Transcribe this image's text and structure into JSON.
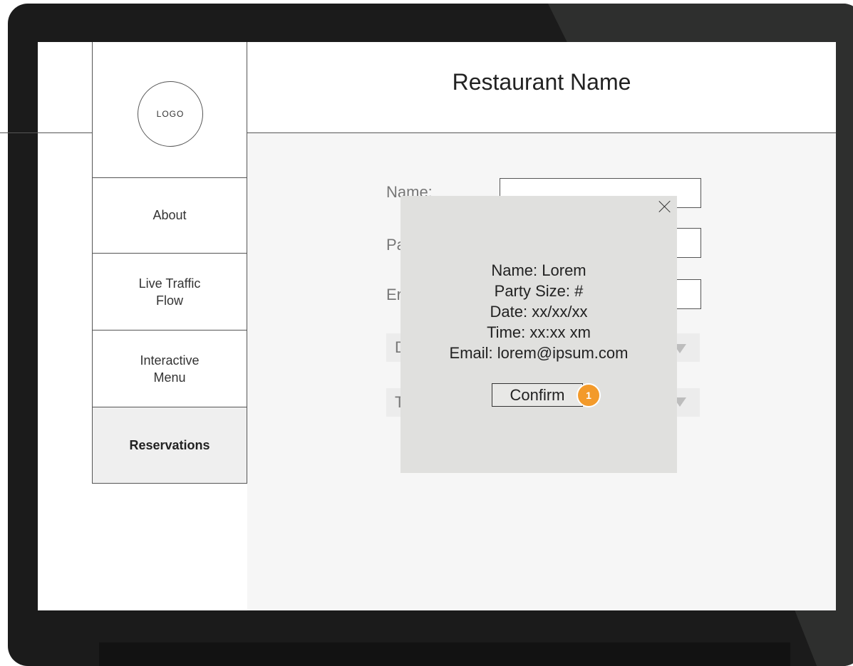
{
  "header": {
    "title": "Restaurant Name"
  },
  "sidebar": {
    "logo": "LOGO",
    "items": [
      {
        "label": "About"
      },
      {
        "label": "Live Traffic\nFlow"
      },
      {
        "label": "Interactive\nMenu"
      },
      {
        "label": "Reservations",
        "active": true
      }
    ]
  },
  "form": {
    "name_label": "Name:",
    "party_label": "Pa",
    "email_label": "Er",
    "date_label": "D",
    "time_label": "T"
  },
  "modal": {
    "lines": [
      "Name: Lorem",
      "Party Size: #",
      "Date: xx/xx/xx",
      "Time: xx:xx xm",
      "Email: lorem@ipsum.com"
    ],
    "confirm_label": "Confirm"
  },
  "annotation": {
    "badge": "1",
    "color": "#f39a2a"
  }
}
